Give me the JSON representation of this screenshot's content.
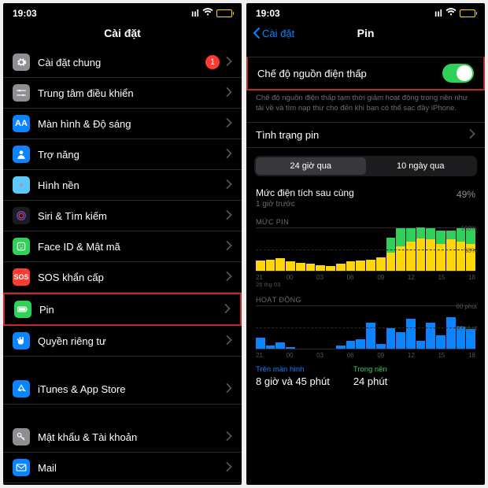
{
  "statusbar": {
    "time": "19:03"
  },
  "left": {
    "title": "Cài đặt",
    "badge_value": "1",
    "items": [
      {
        "label": "Cài đặt chung",
        "icon": "gear",
        "color": "#8e8e93",
        "badge": true
      },
      {
        "label": "Trung tâm điều khiển",
        "icon": "sliders",
        "color": "#8e8e93"
      },
      {
        "label": "Màn hình & Độ sáng",
        "icon": "aa",
        "color": "#0a84ff"
      },
      {
        "label": "Trợ năng",
        "icon": "person",
        "color": "#0a84ff"
      },
      {
        "label": "Hình nền",
        "icon": "flower",
        "color": "#5ac8fa"
      },
      {
        "label": "Siri & Tìm kiếm",
        "icon": "siri",
        "color": "#1c1c1e"
      },
      {
        "label": "Face ID & Mật mã",
        "icon": "face",
        "color": "#30d158"
      },
      {
        "label": "SOS khẩn cấp",
        "icon": "sos",
        "color": "#ff3b30"
      },
      {
        "label": "Pin",
        "icon": "battery",
        "color": "#30d158",
        "hl": true
      },
      {
        "label": "Quyền riêng tư",
        "icon": "hand",
        "color": "#0a84ff"
      },
      {
        "label": "iTunes & App Store",
        "icon": "appstore",
        "color": "#0a84ff",
        "gap": true
      },
      {
        "label": "Mật khẩu & Tài khoản",
        "icon": "key",
        "color": "#8e8e93",
        "gap": true
      },
      {
        "label": "Mail",
        "icon": "mail",
        "color": "#0a84ff"
      }
    ]
  },
  "right": {
    "back": "Cài đặt",
    "title": "Pin",
    "lpm_label": "Chế độ nguồn điện thấp",
    "lpm_desc": "Chế độ nguồn điện thấp tạm thời giảm hoạt động trong nền như tải về và tìm nạp thư cho đến khi bạn có thể sạc đầy iPhone.",
    "health_label": "Tình trạng pin",
    "tab_24h": "24 giờ qua",
    "tab_10d": "10 ngày qua",
    "last_charge_title": "Mức điện tích sau cùng",
    "last_charge_sub": "1 giờ trước",
    "last_charge_pct": "49%",
    "chart1_title": "MỨC PIN",
    "chart2_title": "HOẠT ĐỘNG",
    "y_100": "100%",
    "y_50": "50%",
    "y_60p": "60 phút",
    "y_30p": "30 phút",
    "xlabels": [
      "21",
      "00",
      "03",
      "06",
      "09",
      "12",
      "15",
      "18"
    ],
    "xnote": "26 thg 03",
    "usage_screen_label": "Trên màn hình",
    "usage_screen_value": "8 giờ và 45 phút",
    "usage_bg_label": "Trong nền",
    "usage_bg_value": "24 phút"
  },
  "chart_data": [
    {
      "type": "bar",
      "title": "MỨC PIN",
      "ylabel": "%",
      "ylim": [
        0,
        100
      ],
      "categories": [
        "21",
        "22",
        "23",
        "00",
        "01",
        "02",
        "03",
        "04",
        "05",
        "06",
        "07",
        "08",
        "09",
        "10",
        "11",
        "12",
        "13",
        "14",
        "15",
        "16",
        "17",
        "18"
      ],
      "series": [
        {
          "name": "yellow",
          "values": [
            22,
            25,
            28,
            20,
            18,
            15,
            12,
            10,
            15,
            20,
            22,
            25,
            30,
            40,
            55,
            65,
            72,
            70,
            60,
            70,
            65,
            60
          ]
        },
        {
          "name": "green",
          "values": [
            0,
            0,
            0,
            0,
            0,
            0,
            0,
            0,
            0,
            0,
            0,
            0,
            0,
            35,
            40,
            30,
            25,
            25,
            30,
            20,
            30,
            35
          ]
        }
      ]
    },
    {
      "type": "bar",
      "title": "HOẠT ĐỘNG",
      "ylabel": "phút",
      "ylim": [
        0,
        60
      ],
      "categories": [
        "21",
        "22",
        "23",
        "00",
        "01",
        "02",
        "03",
        "04",
        "05",
        "06",
        "07",
        "08",
        "09",
        "10",
        "11",
        "12",
        "13",
        "14",
        "15",
        "16",
        "17",
        "18"
      ],
      "values": [
        15,
        4,
        8,
        2,
        0,
        0,
        0,
        0,
        4,
        10,
        12,
        35,
        6,
        28,
        22,
        40,
        10,
        35,
        18,
        42,
        30,
        26
      ]
    }
  ]
}
